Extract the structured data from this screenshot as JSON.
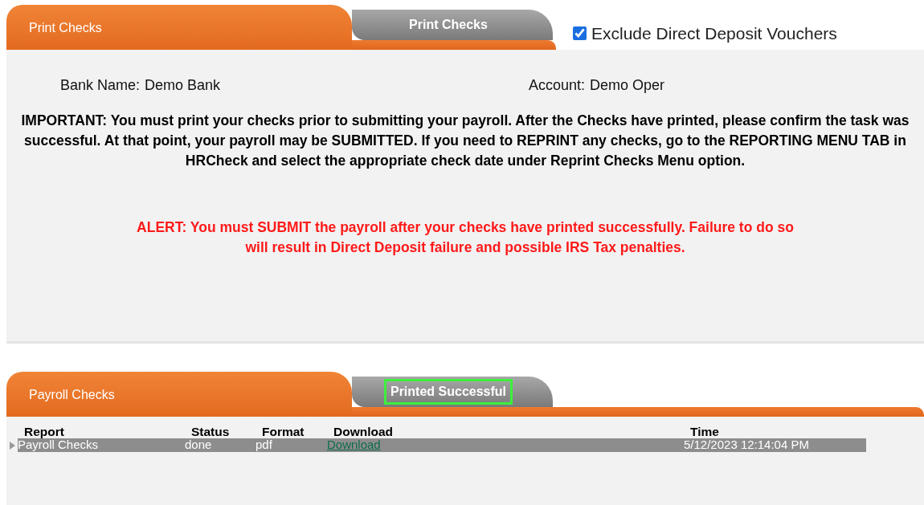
{
  "print_panel": {
    "header_label": "Print Checks",
    "tab": {
      "label": "Print Checks",
      "highlighted": false
    },
    "exclude_checkbox": {
      "label": "Exclude Direct Deposit Vouchers",
      "checked": true
    },
    "fields": [
      {
        "label": "Bank Name:",
        "value": "Demo Bank"
      },
      {
        "label": "Account:",
        "value": "Demo Oper"
      }
    ],
    "important": "IMPORTANT: You must print your checks prior to submitting your payroll. After the Checks have printed, please confirm the task was successful. At that point, your payroll may be SUBMITTED. If you need to REPRINT any checks, go to the REPORTING MENU TAB in HRCheck and select the appropriate check date under Reprint Checks Menu option.",
    "alert": "ALERT: You must SUBMIT the payroll after your checks have printed successfully. Failure to do so will result in Direct Deposit failure and possible IRS Tax penalties."
  },
  "payroll_panel": {
    "header_label": "Payroll Checks",
    "tab": {
      "label": "Printed Successful",
      "highlighted": true
    },
    "table": {
      "columns": [
        "Report",
        "Status",
        "Format",
        "Download",
        "Time"
      ],
      "rows": [
        {
          "report": "Payroll Checks",
          "status": "done",
          "format": "pdf",
          "download": "Download",
          "time": "5/12/2023 12:14:04 PM",
          "selected": true
        }
      ]
    }
  }
}
